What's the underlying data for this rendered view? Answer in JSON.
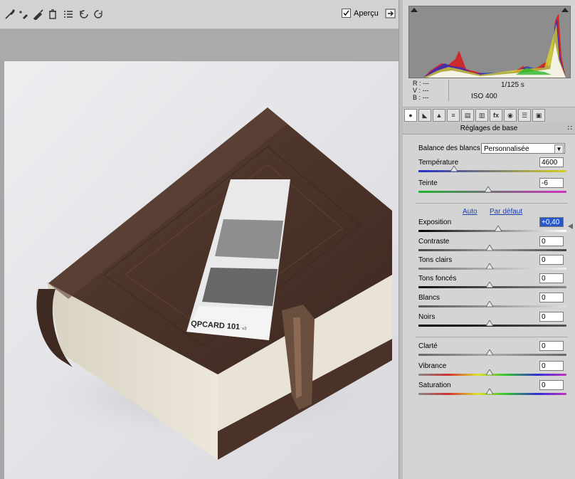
{
  "toolbar": {
    "tools": [
      "white-balance-tool-icon",
      "color-sampler-icon",
      "brush-icon",
      "trash-icon",
      "list-icon",
      "rotate-ccw-icon",
      "rotate-cw-icon"
    ],
    "preview_label": "Aperçu",
    "preview_checked": true
  },
  "info": {
    "r": "R :  ---",
    "v": "V :  ---",
    "b": "B :  ---",
    "shutter": "1/125 s",
    "iso": "ISO 400"
  },
  "panel": {
    "title": "Réglages de base",
    "menu": "∷",
    "tabs": [
      "●",
      "◣",
      "▲",
      "≡",
      "▤",
      "▥",
      "fx",
      "◉",
      "☰",
      "▣"
    ],
    "wb_label": "Balance des blancs :",
    "wb_value": "Personnalisée",
    "auto": "Auto",
    "default": "Par défaut"
  },
  "sliders": {
    "temperature": {
      "label": "Température",
      "value": "4600",
      "fraction": 0.24
    },
    "tint": {
      "label": "Teinte",
      "value": "-6",
      "fraction": 0.47
    },
    "exposure": {
      "label": "Exposition",
      "value": "+0,40",
      "fraction": 0.54
    },
    "contrast": {
      "label": "Contraste",
      "value": "0",
      "fraction": 0.48
    },
    "highlights": {
      "label": "Tons clairs",
      "value": "0",
      "fraction": 0.48
    },
    "shadows": {
      "label": "Tons foncés",
      "value": "0",
      "fraction": 0.48
    },
    "whites": {
      "label": "Blancs",
      "value": "0",
      "fraction": 0.48
    },
    "blacks": {
      "label": "Noirs",
      "value": "0",
      "fraction": 0.48
    },
    "clarity": {
      "label": "Clarté",
      "value": "0",
      "fraction": 0.48
    },
    "vibrance": {
      "label": "Vibrance",
      "value": "0",
      "fraction": 0.48
    },
    "saturation": {
      "label": "Saturation",
      "value": "0",
      "fraction": 0.48
    }
  },
  "photo": {
    "card_brand": "QPCARD 101",
    "card_version": "v3"
  }
}
